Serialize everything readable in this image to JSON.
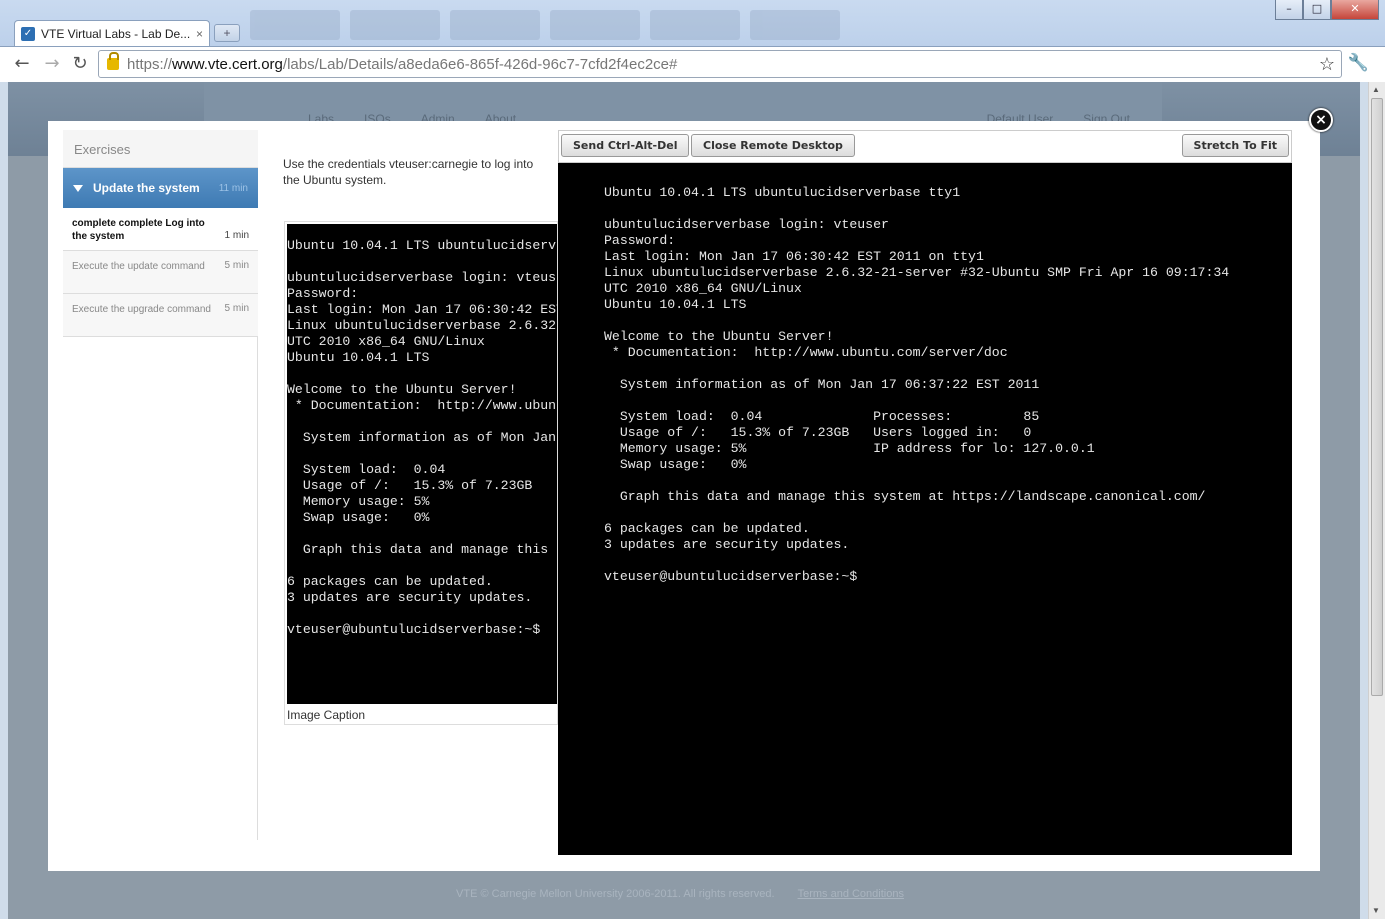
{
  "browser": {
    "tab_title": "VTE Virtual Labs - Lab De...",
    "tab_close": "×",
    "new_tab": "+",
    "url_prefix": "https://",
    "url_domain": "www.vte.cert.org",
    "url_path": "/labs/Lab/Details/a8eda6e6-865f-426d-96c7-7cfd2f4ec2ce#",
    "window_buttons": {
      "minimize": "–",
      "maximize": "□",
      "close": "✕"
    },
    "icons": [
      "back-icon",
      "forward-icon",
      "reload-icon",
      "lock-icon",
      "star-icon",
      "wrench-icon"
    ]
  },
  "site": {
    "nav": [
      "Labs",
      "ISOs",
      "Admin",
      "About"
    ],
    "user": "Default User",
    "signout": "Sign Out",
    "footer_text": "VTE © Carnegie Mellon University 2006-2011. All rights reserved.",
    "footer_link": "Terms and Conditions"
  },
  "modal": {
    "close": "×"
  },
  "sidebar": {
    "title": "Exercises",
    "active": {
      "label": "Update the system",
      "duration": "11 min"
    },
    "items": [
      {
        "label": "complete complete Log into the system",
        "duration": "1 min"
      },
      {
        "label": "Execute the update command",
        "duration": "5 min"
      },
      {
        "label": "Execute the upgrade command",
        "duration": "5 min"
      }
    ]
  },
  "content": {
    "instructions": "Use the credentials vteuser:carnegie to log into the Ubuntu system.",
    "caption": "Image Caption",
    "screenshot_text": "Ubuntu 10.04.1 LTS ubuntulucidserverbase tty1\n\nubuntulucidserverbase login: vteuser\nPassword:\nLast login: Mon Jan 17 06:30:42 EST 2011 on tty1\nLinux ubuntulucidserverbase 2.6.32-21-server #32-Ubuntu SMP Fri Apr 16 09:17:34\nUTC 2010 x86_64 GNU/Linux\nUbuntu 10.04.1 LTS\n\nWelcome to the Ubuntu Server!\n * Documentation:  http://www.ubuntu.com/server/doc\n\n  System information as of Mon Jan 17 06:37:22 EST 2011\n\n  System load:  0.04\n  Usage of /:   15.3% of 7.23GB\n  Memory usage: 5%\n  Swap usage:   0%\n\n  Graph this data and manage this system at https://landscape.canonical.com/\n\n6 packages can be updated.\n3 updates are security updates.\n\nvteuser@ubuntulucidserverbase:~$"
  },
  "rdp": {
    "send_ctrl_alt_del": "Send Ctrl-Alt-Del",
    "close_remote": "Close Remote Desktop",
    "stretch": "Stretch To Fit",
    "terminal_text": "Ubuntu 10.04.1 LTS ubuntulucidserverbase tty1\n\nubuntulucidserverbase login: vteuser\nPassword:\nLast login: Mon Jan 17 06:30:42 EST 2011 on tty1\nLinux ubuntulucidserverbase 2.6.32-21-server #32-Ubuntu SMP Fri Apr 16 09:17:34\nUTC 2010 x86_64 GNU/Linux\nUbuntu 10.04.1 LTS\n\nWelcome to the Ubuntu Server!\n * Documentation:  http://www.ubuntu.com/server/doc\n\n  System information as of Mon Jan 17 06:37:22 EST 2011\n\n  System load:  0.04              Processes:         85\n  Usage of /:   15.3% of 7.23GB   Users logged in:   0\n  Memory usage: 5%                IP address for lo: 127.0.0.1\n  Swap usage:   0%\n\n  Graph this data and manage this system at https://landscape.canonical.com/\n\n6 packages can be updated.\n3 updates are security updates.\n\nvteuser@ubuntulucidserverbase:~$"
  },
  "colors": {
    "accent": "#3e7ab3",
    "terminal_bg": "#000000",
    "terminal_fg": "#e6e6e6"
  }
}
